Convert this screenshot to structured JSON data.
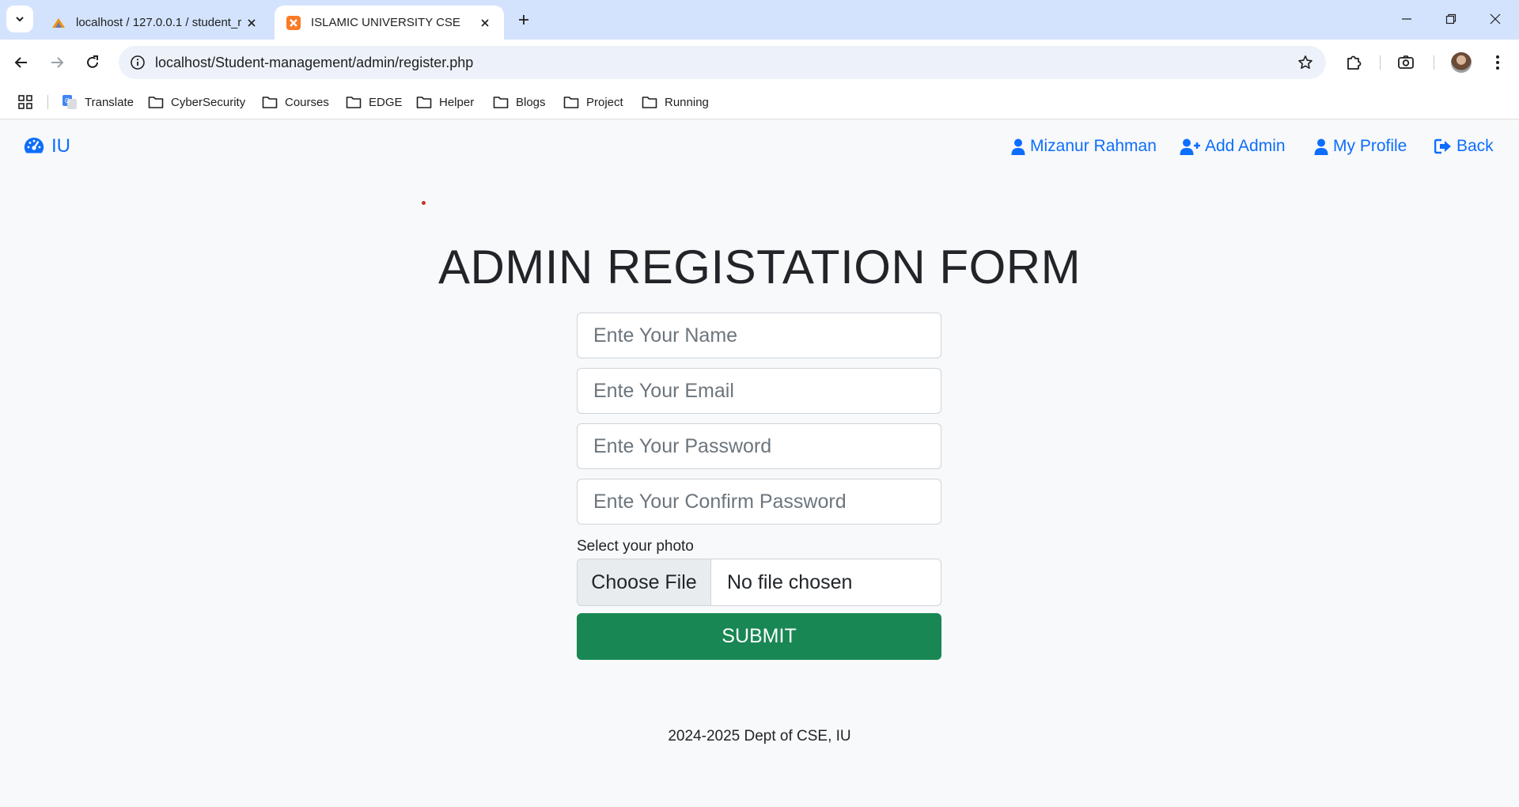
{
  "browser": {
    "tabs": [
      {
        "title": "localhost / 127.0.0.1 / student_r",
        "active": false
      },
      {
        "title": "ISLAMIC UNIVERSITY CSE",
        "active": true
      }
    ],
    "url": "localhost/Student-management/admin/register.php",
    "bookmarks": [
      "Translate",
      "CyberSecurity",
      "Courses",
      "EDGE",
      "Helper",
      "Blogs",
      "Project",
      "Running"
    ]
  },
  "navbar": {
    "brand": "IU",
    "links": [
      "Mizanur Rahman",
      "Add Admin",
      "My Profile",
      "Back"
    ]
  },
  "form": {
    "title": "ADMIN REGISTATION FORM",
    "name_placeholder": "Ente Your Name",
    "email_placeholder": "Ente Your Email",
    "password_placeholder": "Ente Your Password",
    "confirm_placeholder": "Ente Your Confirm Password",
    "photo_label": "Select your photo",
    "file_button": "Choose File",
    "file_status": "No file chosen",
    "submit_label": "SUBMIT"
  },
  "footer": {
    "text": "2024-2025 Dept of CSE, IU"
  },
  "colors": {
    "link": "#0d6efd",
    "submit": "#198754",
    "tabstrip": "#d3e3fd"
  }
}
